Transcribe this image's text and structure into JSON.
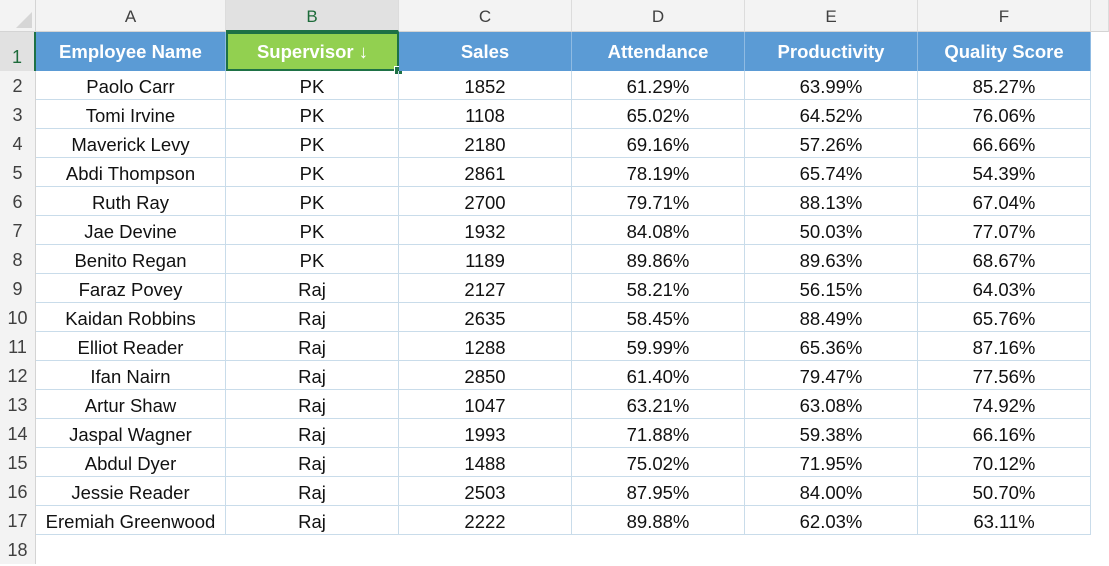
{
  "sheet": {
    "column_letters": [
      "A",
      "B",
      "C",
      "D",
      "E",
      "F"
    ],
    "selected_column": "B",
    "selected_row": 1,
    "row_numbers": [
      1,
      2,
      3,
      4,
      5,
      6,
      7,
      8,
      9,
      10,
      11,
      12,
      13,
      14,
      15,
      16,
      17,
      18
    ],
    "colors": {
      "header_fill": "#5b9bd5",
      "selected_header_fill": "#92d050",
      "selection_border": "#1e7145",
      "header_text": "#ffffff"
    },
    "headers": [
      "Employee Name",
      "Supervisor ↓",
      "Sales",
      "Attendance",
      "Productivity",
      "Quality Score"
    ],
    "rows": [
      [
        "Paolo Carr",
        "PK",
        "1852",
        "61.29%",
        "63.99%",
        "85.27%"
      ],
      [
        "Tomi Irvine",
        "PK",
        "1108",
        "65.02%",
        "64.52%",
        "76.06%"
      ],
      [
        "Maverick Levy",
        "PK",
        "2180",
        "69.16%",
        "57.26%",
        "66.66%"
      ],
      [
        "Abdi Thompson",
        "PK",
        "2861",
        "78.19%",
        "65.74%",
        "54.39%"
      ],
      [
        "Ruth Ray",
        "PK",
        "2700",
        "79.71%",
        "88.13%",
        "67.04%"
      ],
      [
        "Jae Devine",
        "PK",
        "1932",
        "84.08%",
        "50.03%",
        "77.07%"
      ],
      [
        "Benito Regan",
        "PK",
        "1189",
        "89.86%",
        "89.63%",
        "68.67%"
      ],
      [
        "Faraz Povey",
        "Raj",
        "2127",
        "58.21%",
        "56.15%",
        "64.03%"
      ],
      [
        "Kaidan Robbins",
        "Raj",
        "2635",
        "58.45%",
        "88.49%",
        "65.76%"
      ],
      [
        "Elliot Reader",
        "Raj",
        "1288",
        "59.99%",
        "65.36%",
        "87.16%"
      ],
      [
        "Ifan Nairn",
        "Raj",
        "2850",
        "61.40%",
        "79.47%",
        "77.56%"
      ],
      [
        "Artur Shaw",
        "Raj",
        "1047",
        "63.21%",
        "63.08%",
        "74.92%"
      ],
      [
        "Jaspal Wagner",
        "Raj",
        "1993",
        "71.88%",
        "59.38%",
        "66.16%"
      ],
      [
        "Abdul Dyer",
        "Raj",
        "1488",
        "75.02%",
        "71.95%",
        "70.12%"
      ],
      [
        "Jessie Reader",
        "Raj",
        "2503",
        "87.95%",
        "84.00%",
        "50.70%"
      ],
      [
        "Eremiah Greenwood",
        "Raj",
        "2222",
        "89.88%",
        "62.03%",
        "63.11%"
      ]
    ]
  }
}
